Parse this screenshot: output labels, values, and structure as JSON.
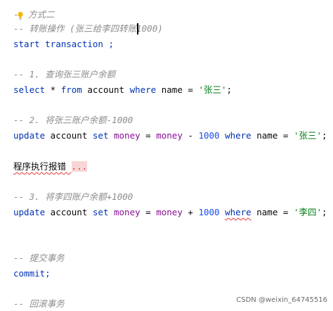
{
  "lines": {
    "l1_prefix": "-",
    "l1_text": "方式二",
    "l2": "-- 转账操作 (张三给李四转账1000)",
    "l3": "start transaction ;",
    "l4": "-- 1. 查询张三账户余额",
    "l5": {
      "select": "select",
      "star": " * ",
      "from": "from",
      "table": " account ",
      "where": "where",
      "col": " name = ",
      "str": "'张三'",
      "end": ";"
    },
    "l6": "-- 2. 将张三账户余额-1000",
    "l7": {
      "update": "update",
      "table": " account ",
      "set": "set",
      "sp1": " ",
      "money1": "money",
      "eq": " = ",
      "money2": "money",
      "minus": " - ",
      "num": "1000",
      "sp2": " ",
      "where": "where",
      "col": " name = ",
      "str": "'张三'",
      "end": ";"
    },
    "l8": {
      "text": "程序执行报错 ",
      "dots": "..."
    },
    "l9": "-- 3. 将李四账户余额+1000",
    "l10": {
      "update": "update",
      "table": " account ",
      "set": "set",
      "sp1": " ",
      "money1": "money",
      "eq": " = ",
      "money2": "money",
      "plus": " + ",
      "num": "1000",
      "sp2": " ",
      "where": "where",
      "col": " name = ",
      "str": "'李四'",
      "end": ";"
    },
    "l11": "-- 提交事务",
    "l12": "commit;",
    "l13": "-- 回滚事务"
  },
  "watermark": "CSDN @weixin_64745516",
  "icons": {
    "bulb": "lightbulb-icon"
  },
  "colors": {
    "comment": "#8c8c8c",
    "keyword": "#0033b3",
    "string": "#067d17",
    "number": "#1750eb",
    "column": "#871094"
  }
}
